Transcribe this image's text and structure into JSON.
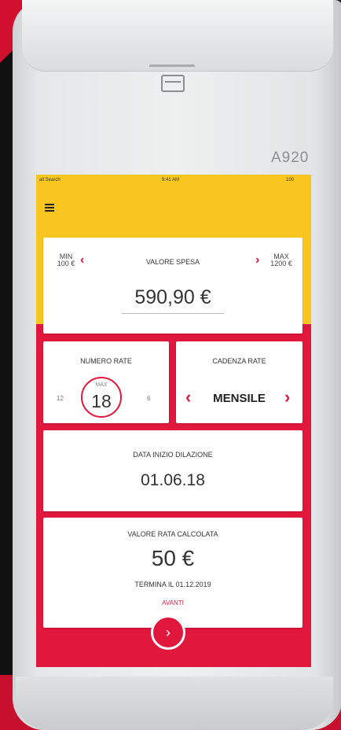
{
  "device": {
    "model": "A920"
  },
  "status_bar": {
    "carrier": "all Search",
    "time": "9:41 AM",
    "battery": "100"
  },
  "header": {
    "menu_icon": "menu-icon"
  },
  "spend_card": {
    "label": "VALORE SPESA",
    "min_label": "MIN",
    "min_value": "100 €",
    "max_label": "MAX",
    "max_value": "1200 €",
    "value": "590,90 €"
  },
  "installments_card": {
    "label": "NUMERO RATE",
    "prev_value": "12",
    "max_label": "MAX",
    "current_value": "18",
    "next_value": "6"
  },
  "frequency_card": {
    "label": "CADENZA RATE",
    "value": "MENSILE"
  },
  "start_date_card": {
    "label": "DATA INIZIO DILAZIONE",
    "value": "01.06.18"
  },
  "calc_card": {
    "label": "VALORE RATA CALCOLATA",
    "value": "50 €",
    "end_text": "TERMINA IL 01.12.2019",
    "next_label": "AVANTI"
  },
  "colors": {
    "accent": "#e2173d",
    "header_yellow": "#f9c51f"
  }
}
